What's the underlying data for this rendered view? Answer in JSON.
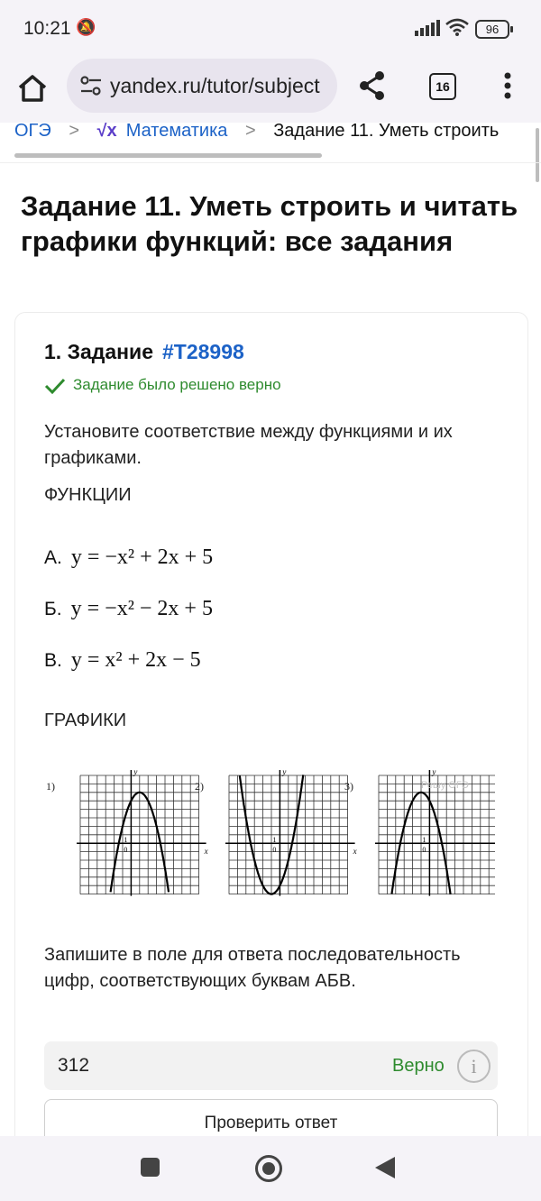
{
  "status": {
    "time": "10:21",
    "battery": "96"
  },
  "browser": {
    "url": "yandex.ru/tutor/subject",
    "tab_count": "16"
  },
  "breadcrumbs": [
    {
      "label": "ОГЭ"
    },
    {
      "label": "Математика",
      "logo": "√x"
    },
    {
      "label": "Задание 11. Уметь строить"
    }
  ],
  "page": {
    "title": "Задание 11. Уметь строить и читать графики функций: все задания"
  },
  "task": {
    "title": "1. Задание",
    "id": "#T28998",
    "solved_text": "Задание было решено верно",
    "intro": "Установите соответствие между функциями и их графиками.",
    "functions_heading": "ФУНКЦИИ",
    "functions": [
      {
        "label": "А.",
        "formula": "y = −x² + 2x + 5"
      },
      {
        "label": "Б.",
        "formula": "y = −x² − 2x + 5"
      },
      {
        "label": "В.",
        "formula": "y = x² + 2x − 5"
      }
    ],
    "graphs_heading": "ГРАФИКИ",
    "graph_labels": [
      "1)",
      "2)",
      "3)"
    ],
    "watermark": "Решу ОГЭ",
    "instruction": "Запишите в поле для ответа последовательность цифр, соответствующих буквам АБВ.",
    "answer_value": "312",
    "answer_status": "Верно",
    "check_button": "Проверить ответ"
  },
  "colors": {
    "link": "#1c62c7",
    "success": "#2e8b2e",
    "logo": "#5c3fc9"
  }
}
